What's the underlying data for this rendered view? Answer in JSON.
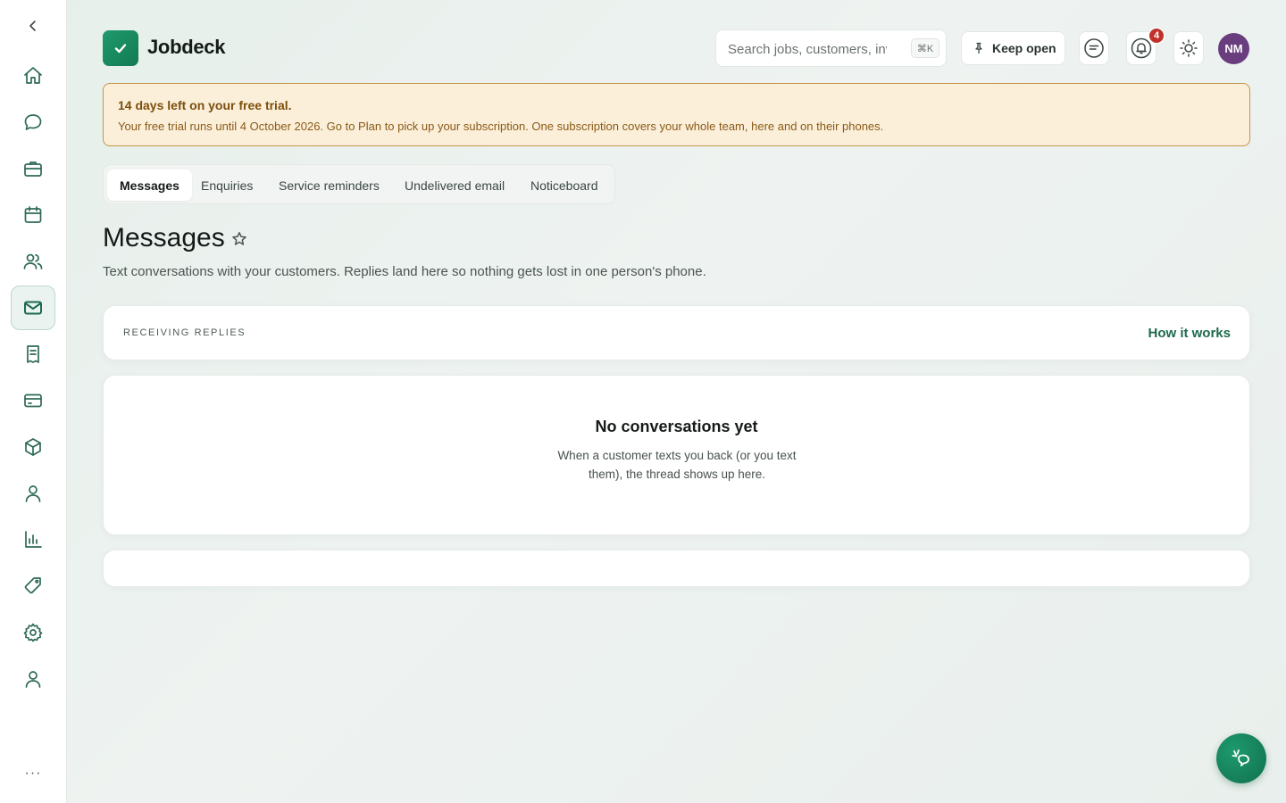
{
  "sidebar": {
    "collapse_icon": "chevron-left-icon",
    "items": [
      {
        "name": "home",
        "icon": "home-icon"
      },
      {
        "name": "chat",
        "icon": "chat-bubble-icon"
      },
      {
        "name": "jobs",
        "icon": "briefcase-icon"
      },
      {
        "name": "calendar",
        "icon": "calendar-icon"
      },
      {
        "name": "customers",
        "icon": "users-icon"
      },
      {
        "name": "messages",
        "icon": "mail-icon",
        "active": true
      },
      {
        "name": "receipts",
        "icon": "receipt-icon"
      },
      {
        "name": "payments",
        "icon": "credit-card-icon"
      },
      {
        "name": "products",
        "icon": "box-icon"
      },
      {
        "name": "team",
        "icon": "user-icon"
      },
      {
        "name": "reports",
        "icon": "bar-chart-icon"
      },
      {
        "name": "pricing",
        "icon": "tag-icon"
      },
      {
        "name": "settings",
        "icon": "gear-icon"
      },
      {
        "name": "account",
        "icon": "user-icon"
      }
    ],
    "more_label": "···"
  },
  "header": {
    "app_name": "Jobdeck",
    "search_placeholder": "Search jobs, customers, invoices",
    "search_shortcut": "⌘K",
    "keep_open_label": "Keep open",
    "notification_count": "4",
    "avatar_initials": "NM"
  },
  "trial": {
    "title": "14 days left on your free trial.",
    "text": "Your free trial runs until 4 October 2026. Go to Plan to pick up your subscription. One subscription covers your whole team, here and on their phones."
  },
  "tabs": [
    {
      "label": "Messages",
      "active": true
    },
    {
      "label": "Enquiries"
    },
    {
      "label": "Service reminders"
    },
    {
      "label": "Undelivered email"
    },
    {
      "label": "Noticeboard"
    }
  ],
  "page": {
    "title": "Messages",
    "description": "Text conversations with your customers. Replies land here so nothing gets lost in one person's phone."
  },
  "replies_card": {
    "label": "RECEIVING REPLIES",
    "link": "How it works"
  },
  "empty_state": {
    "title": "No conversations yet",
    "text": "When a customer texts you back (or you text them), the thread shows up here."
  },
  "colors": {
    "brand": "#137a54",
    "accent_link": "#1d6a4d",
    "trial_bg": "#fbefd9",
    "trial_border": "#c5944a",
    "badge": "#c0312b",
    "avatar": "#6a3d7e"
  }
}
